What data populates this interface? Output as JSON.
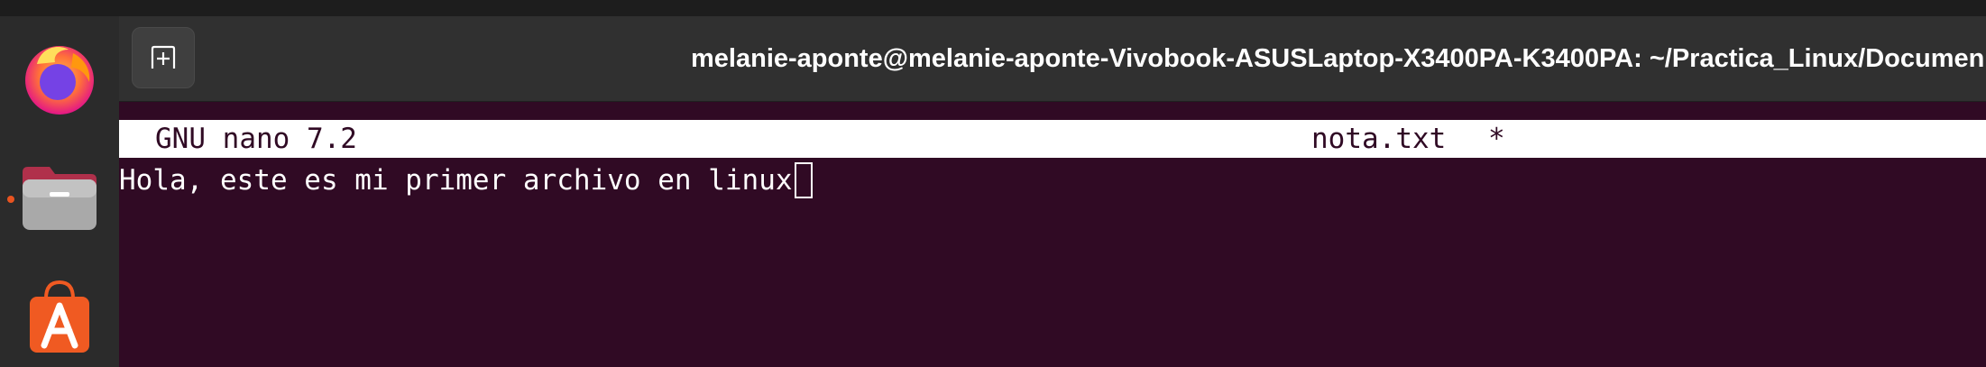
{
  "dock": {
    "items": [
      {
        "name": "Firefox",
        "icon": "firefox-icon",
        "running": false
      },
      {
        "name": "Files",
        "icon": "files-folder-icon",
        "running": true
      },
      {
        "name": "App Center",
        "icon": "app-center-icon",
        "running": false
      }
    ],
    "running_indicator_color": "#e95420"
  },
  "window": {
    "title": "melanie-aponte@melanie-aponte-Vivobook-ASUSLaptop-X3400PA-K3400PA: ~/Practica_Linux/Documen",
    "new_tab_icon": "new-tab-icon"
  },
  "nano": {
    "version": "GNU nano 7.2",
    "filename": "nota.txt",
    "modified_marker": "*",
    "lines": [
      "Hola, este es mi primer archivo en linux"
    ]
  },
  "colors": {
    "terminal_bg": "#300a24",
    "header_bg": "#ffffff",
    "titlebar_bg": "#303030",
    "dock_bg": "#2b2b2b"
  }
}
